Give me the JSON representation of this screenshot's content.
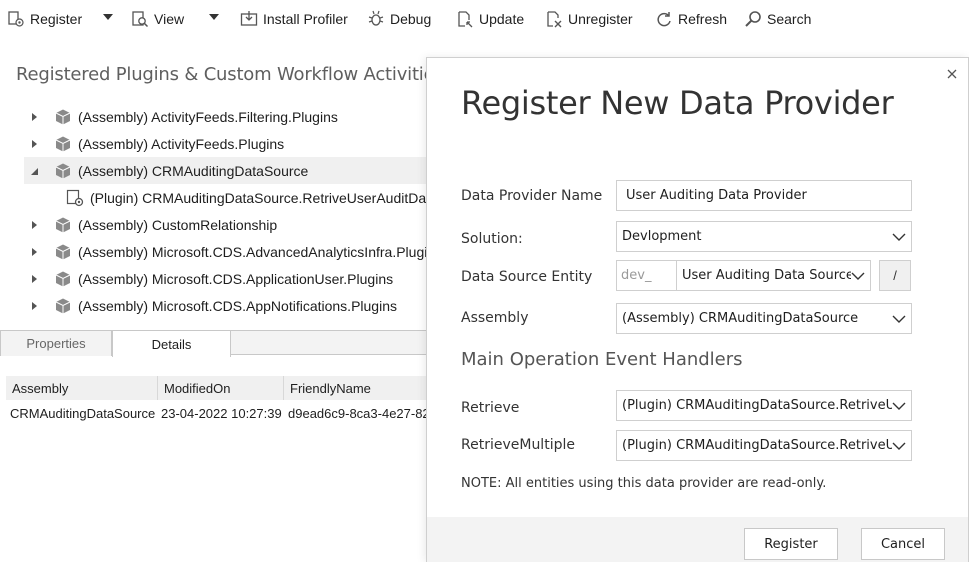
{
  "toolbar": {
    "register": "Register",
    "view": "View",
    "install_profiler": "Install Profiler",
    "debug": "Debug",
    "update": "Update",
    "unregister": "Unregister",
    "refresh": "Refresh",
    "search": "Search"
  },
  "tree": {
    "title": "Registered Plugins & Custom Workflow Activities",
    "items": [
      {
        "label": "(Assembly) ActivityFeeds.Filtering.Plugins",
        "expanded": false
      },
      {
        "label": "(Assembly) ActivityFeeds.Plugins",
        "expanded": false
      },
      {
        "label": "(Assembly) CRMAuditingDataSource",
        "expanded": true,
        "selected": true
      },
      {
        "label": "(Plugin) CRMAuditingDataSource.RetriveUserAuditDa",
        "child": true
      },
      {
        "label": "(Assembly) CustomRelationship",
        "expanded": false
      },
      {
        "label": "(Assembly) Microsoft.CDS.AdvancedAnalyticsInfra.Plugin",
        "expanded": false
      },
      {
        "label": "(Assembly) Microsoft.CDS.ApplicationUser.Plugins",
        "expanded": false
      },
      {
        "label": "(Assembly) Microsoft.CDS.AppNotifications.Plugins",
        "expanded": false
      }
    ]
  },
  "tabs": {
    "properties": "Properties",
    "details": "Details"
  },
  "grid": {
    "columns": [
      "Assembly",
      "ModifiedOn",
      "FriendlyName"
    ],
    "row": [
      "CRMAuditingDataSource",
      "23-04-2022 10:27:39",
      "d9ead6c9-8ca3-4e27-82"
    ]
  },
  "dialog": {
    "title": "Register New Data Provider",
    "provider_name_label": "Data Provider Name",
    "provider_name_value": "User Auditing Data Provider",
    "solution_label": "Solution:",
    "solution_value": "Devlopment",
    "entity_label": "Data Source Entity",
    "entity_prefix": "dev_",
    "entity_value": "User Auditing Data Source",
    "entity_button": "/",
    "assembly_label": "Assembly",
    "assembly_value": "(Assembly) CRMAuditingDataSource",
    "handlers_heading": "Main Operation Event Handlers",
    "retrieve_label": "Retrieve",
    "retrieve_value": "(Plugin) CRMAuditingDataSource.RetriveUser.",
    "retrieve_multiple_label": "RetrieveMultiple",
    "retrieve_multiple_value": "(Plugin) CRMAuditingDataSource.RetriveUser.",
    "note": "NOTE: All entities using this data provider are read-only.",
    "register_button": "Register",
    "cancel_button": "Cancel",
    "close_glyph": "×"
  }
}
